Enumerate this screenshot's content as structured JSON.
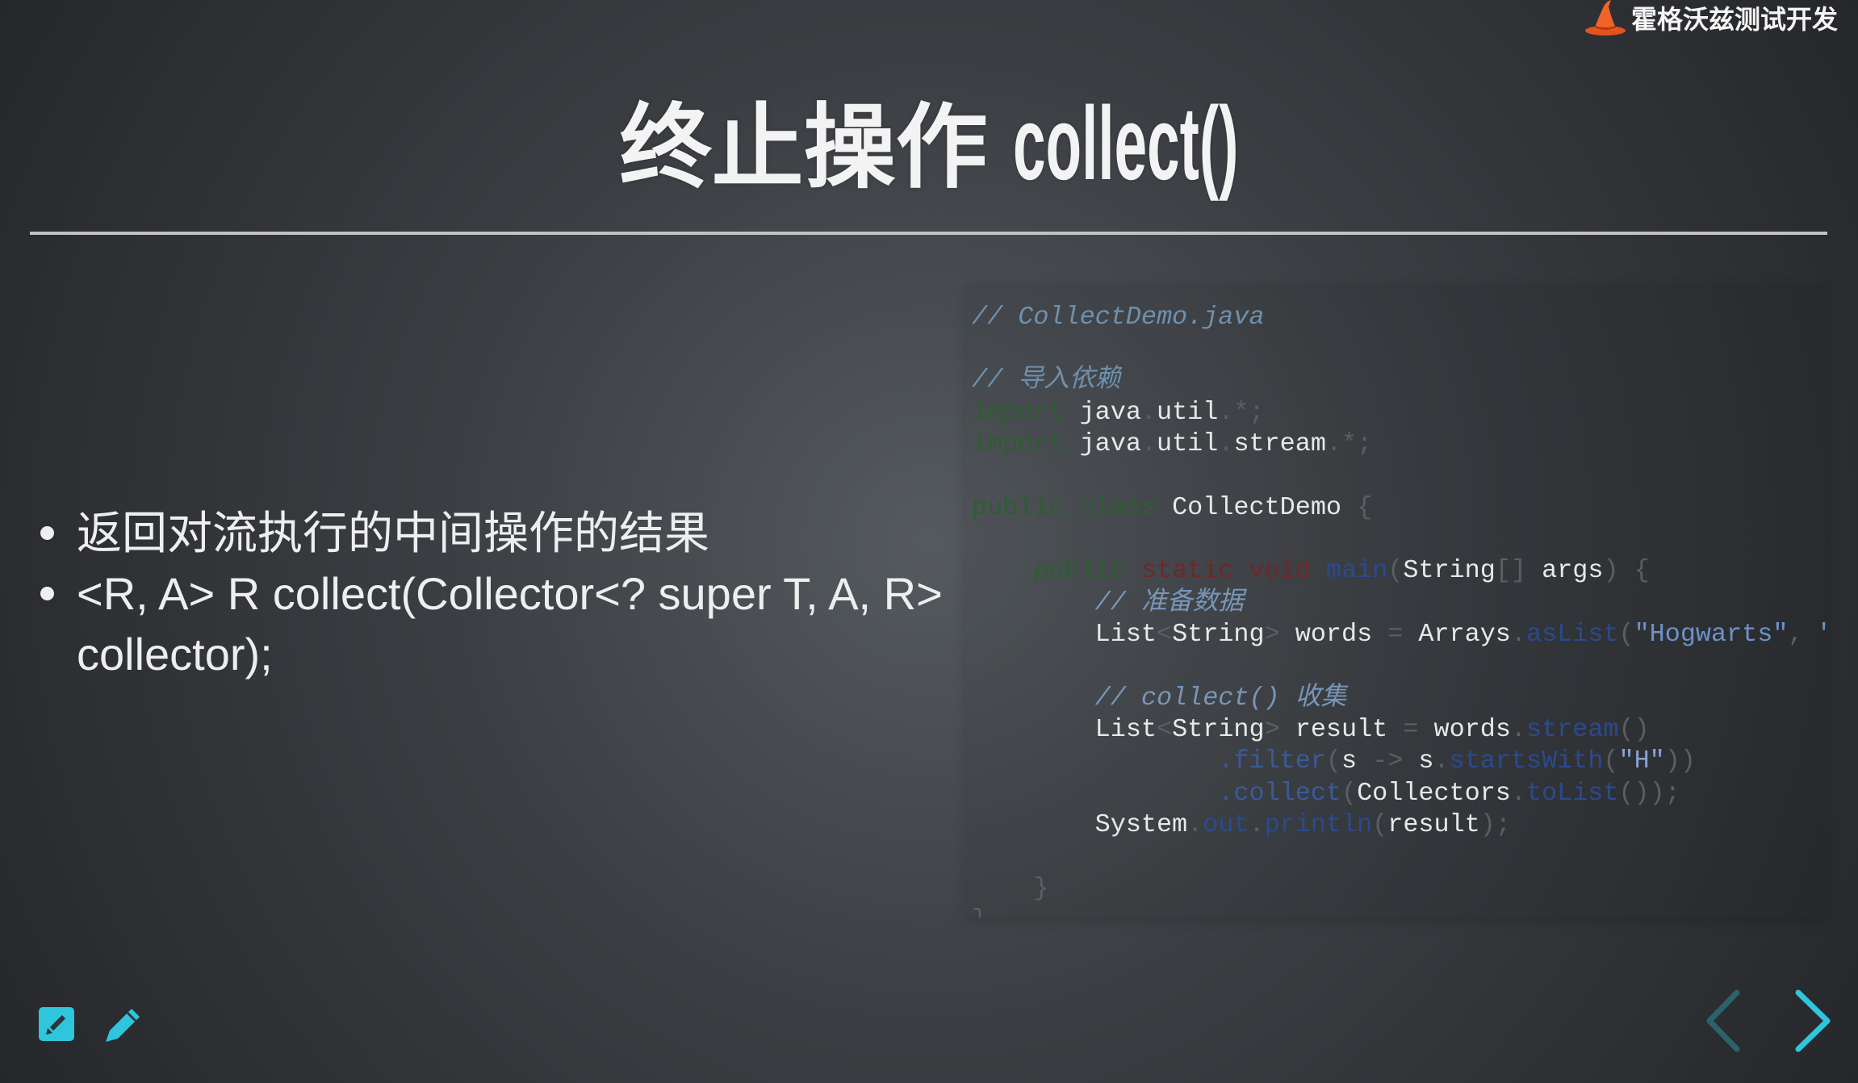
{
  "header": {
    "brand_name": "霍格沃兹测试开发",
    "logo_icon": "wizard-hat-icon"
  },
  "slide": {
    "title_main": "终止操作",
    "title_code": "collect()",
    "bullets": [
      "返回对流执行的中间操作的结果",
      "<R, A> R collect(Collector<? super T, A, R> collector);"
    ]
  },
  "code": {
    "lines": [
      [
        [
          "// CollectDemo.java",
          "#6f90ad"
        ]
      ],
      [],
      [
        [
          "// 导入依赖",
          "#6f90ad"
        ]
      ],
      [
        [
          "import",
          "#2d5e31"
        ],
        [
          " ",
          "#5b5e63"
        ],
        [
          "java",
          "#e8e8e8"
        ],
        [
          ".",
          "#5b5e63"
        ],
        [
          "util",
          "#e8e8e8"
        ],
        [
          ".*;",
          "#5b5e63"
        ]
      ],
      [
        [
          "import",
          "#2d5e31"
        ],
        [
          " ",
          "#5b5e63"
        ],
        [
          "java",
          "#e8e8e8"
        ],
        [
          ".",
          "#5b5e63"
        ],
        [
          "util",
          "#e8e8e8"
        ],
        [
          ".",
          "#5b5e63"
        ],
        [
          "stream",
          "#e8e8e8"
        ],
        [
          ".*;",
          "#5b5e63"
        ]
      ],
      [],
      [
        [
          "public",
          "#2d5e31"
        ],
        [
          " ",
          "#5b5e63"
        ],
        [
          "class",
          "#2d5e31"
        ],
        [
          " ",
          "#5b5e63"
        ],
        [
          "CollectDemo",
          "#e8e8e8"
        ],
        [
          " {",
          "#5b5e63"
        ]
      ],
      [],
      [
        [
          "    ",
          "#5b5e63"
        ],
        [
          "public",
          "#2d5e31"
        ],
        [
          " ",
          "#5b5e63"
        ],
        [
          "static",
          "#6e2828"
        ],
        [
          " ",
          "#5b5e63"
        ],
        [
          "void",
          "#6e2828"
        ],
        [
          " ",
          "#5b5e63"
        ],
        [
          "main",
          "#2b4a8e"
        ],
        [
          "(",
          "#5b5e63"
        ],
        [
          "String",
          "#e8e8e8"
        ],
        [
          "[] ",
          "#5b5e63"
        ],
        [
          "args",
          "#e8e8e8"
        ],
        [
          ") {",
          "#5b5e63"
        ]
      ],
      [
        [
          "        ",
          "#5b5e63"
        ],
        [
          "// 准备数据",
          "#7896b8"
        ]
      ],
      [
        [
          "        ",
          "#5b5e63"
        ],
        [
          "List",
          "#e8e8e8"
        ],
        [
          "<",
          "#5b5e63"
        ],
        [
          "String",
          "#e8e8e8"
        ],
        [
          "> ",
          "#5b5e63"
        ],
        [
          "words",
          "#e8e8e8"
        ],
        [
          " = ",
          "#5b5e63"
        ],
        [
          "Arrays",
          "#e8e8e8"
        ],
        [
          ".",
          "#5b5e63"
        ],
        [
          "asList",
          "#2b4a8e"
        ],
        [
          "(",
          "#5b5e63"
        ],
        [
          "\"Hogwarts\"",
          "#6d92c9"
        ],
        [
          ", ",
          "#5b5e63"
        ],
        [
          "\"",
          "#6d92c9"
        ]
      ],
      [],
      [
        [
          "        ",
          "#5b5e63"
        ],
        [
          "// collect() 收集",
          "#7896b8"
        ]
      ],
      [
        [
          "        ",
          "#5b5e63"
        ],
        [
          "List",
          "#e8e8e8"
        ],
        [
          "<",
          "#5b5e63"
        ],
        [
          "String",
          "#e8e8e8"
        ],
        [
          "> ",
          "#5b5e63"
        ],
        [
          "result",
          "#e8e8e8"
        ],
        [
          " = ",
          "#5b5e63"
        ],
        [
          "words",
          "#e8e8e8"
        ],
        [
          ".",
          "#5b5e63"
        ],
        [
          "stream",
          "#2b4a8e"
        ],
        [
          "()",
          "#5b5e63"
        ]
      ],
      [
        [
          "                ",
          "#5b5e63"
        ],
        [
          ".filter",
          "#3a5a9c"
        ],
        [
          "(",
          "#5b5e63"
        ],
        [
          "s",
          "#e8e8e8"
        ],
        [
          " -> ",
          "#5b5e63"
        ],
        [
          "s",
          "#e8e8e8"
        ],
        [
          ".",
          "#5b5e63"
        ],
        [
          "startsWith",
          "#2b4a8e"
        ],
        [
          "(",
          "#5b5e63"
        ],
        [
          "\"H\"",
          "#87a3d2"
        ],
        [
          "))",
          "#5b5e63"
        ]
      ],
      [
        [
          "                ",
          "#5b5e63"
        ],
        [
          ".collect",
          "#3a5a9c"
        ],
        [
          "(",
          "#5b5e63"
        ],
        [
          "Collectors",
          "#e8e8e8"
        ],
        [
          ".",
          "#5b5e63"
        ],
        [
          "toList",
          "#2b4a8e"
        ],
        [
          "());",
          "#5b5e63"
        ]
      ],
      [
        [
          "        ",
          "#5b5e63"
        ],
        [
          "System",
          "#e8e8e8"
        ],
        [
          ".",
          "#5b5e63"
        ],
        [
          "out",
          "#2b4a8e"
        ],
        [
          ".",
          "#5b5e63"
        ],
        [
          "println",
          "#2b4a8e"
        ],
        [
          "(",
          "#5b5e63"
        ],
        [
          "result",
          "#e8e8e8"
        ],
        [
          ");",
          "#5b5e63"
        ]
      ],
      [],
      [
        [
          "    ",
          "#5b5e63"
        ],
        [
          "}",
          "#5b5e63"
        ]
      ],
      [
        [
          "}",
          "#5b5e63"
        ]
      ]
    ]
  },
  "controls": {
    "notes_icon": "pen-square-icon",
    "chalkboard_icon": "pencil-icon",
    "prev_icon": "chevron-left-icon",
    "next_icon": "chevron-right-icon"
  },
  "colors": {
    "accent": "#2ec5dd",
    "text": "#eeeeee",
    "background_center": "#555a5f",
    "background_edge": "#25272a",
    "rule": "#c2c2c2",
    "logo_orange": "#e4531c"
  }
}
